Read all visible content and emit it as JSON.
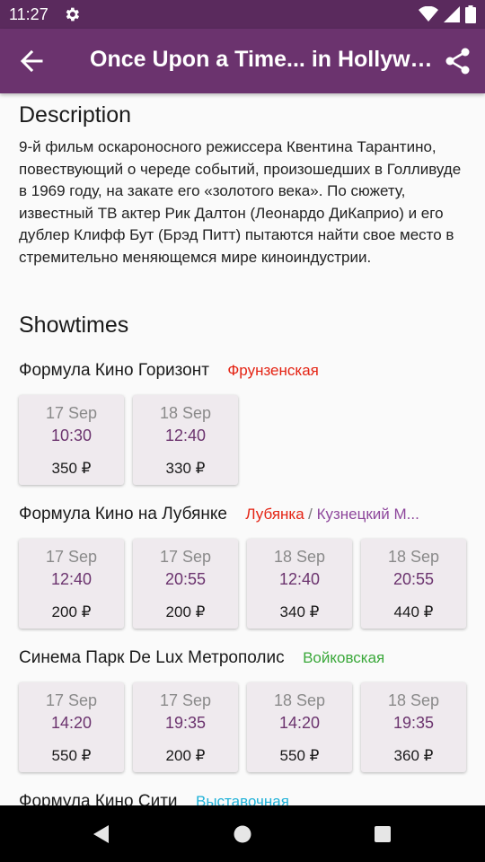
{
  "status_bar": {
    "time": "11:27"
  },
  "app_bar": {
    "title": "Once Upon a Time... in Hollywood"
  },
  "description": {
    "heading": "Description",
    "text": "9-й фильм оскароносного режиссера Квентина Тарантино, повествующий о череде событий, произошедших в Голливуде в 1969 году, на закате его «золотого века». По сюжету, известный ТВ актер Рик Далтон (Леонардо ДиКаприо) и его дублер Клифф Бут (Брэд Питт) пытаются найти свое место в стремительно меняющемся мире киноиндустрии."
  },
  "showtimes": {
    "heading": "Showtimes",
    "cinemas": [
      {
        "name": "Формула Кино Горизонт",
        "metro": [
          {
            "name": "Фрунзенская",
            "color": "#e42313"
          }
        ],
        "sessions": [
          {
            "date": "17 Sep",
            "time": "10:30",
            "price": "350 ₽"
          },
          {
            "date": "18 Sep",
            "time": "12:40",
            "price": "330 ₽"
          }
        ]
      },
      {
        "name": "Формула Кино на Лубянке",
        "metro": [
          {
            "name": "Лубянка",
            "color": "#e42313"
          },
          {
            "name": "Кузнецкий М...",
            "color": "#8e479c"
          }
        ],
        "sessions": [
          {
            "date": "17 Sep",
            "time": "12:40",
            "price": "200 ₽"
          },
          {
            "date": "17 Sep",
            "time": "20:55",
            "price": "200 ₽"
          },
          {
            "date": "18 Sep",
            "time": "12:40",
            "price": "340 ₽"
          },
          {
            "date": "18 Sep",
            "time": "20:55",
            "price": "440 ₽"
          }
        ]
      },
      {
        "name": "Синема Парк De Lux Метрополис",
        "metro": [
          {
            "name": "Войковская",
            "color": "#3aa83a"
          }
        ],
        "sessions": [
          {
            "date": "17 Sep",
            "time": "14:20",
            "price": "550 ₽"
          },
          {
            "date": "17 Sep",
            "time": "19:35",
            "price": "200 ₽"
          },
          {
            "date": "18 Sep",
            "time": "14:20",
            "price": "550 ₽"
          },
          {
            "date": "18 Sep",
            "time": "19:35",
            "price": "360 ₽"
          }
        ]
      },
      {
        "name": "Формула Кино Сити",
        "metro": [
          {
            "name": "Выставочная",
            "color": "#1fb1d8"
          }
        ],
        "sessions": []
      }
    ]
  },
  "colors": {
    "app_bar": "#6b336e",
    "status_bar": "#5a2a5d",
    "accent": "#6b336e"
  },
  "icons": {
    "back": "arrow-back-icon",
    "share": "share-icon",
    "settings": "gear-icon"
  }
}
